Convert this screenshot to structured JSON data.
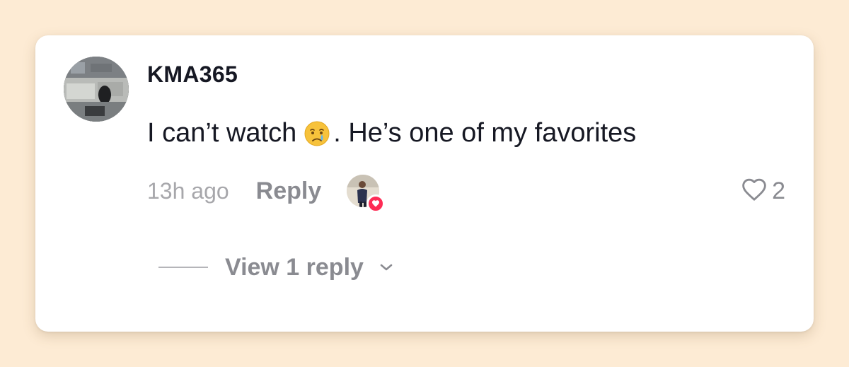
{
  "comment": {
    "username": "KMA365",
    "text_before_emoji": "I can’t watch",
    "emoji": "crying-face-emoji",
    "text_after_emoji": ". He’s one of my favorites",
    "timestamp": "13h ago",
    "reply_label": "Reply",
    "like_count": "2",
    "view_replies_label": "View 1 reply"
  },
  "icons": {
    "like": "heart-outline-icon",
    "expand": "chevron-down-icon",
    "liked_by_creator": "heart-badge-icon"
  },
  "colors": {
    "page_background": "#fdebd4",
    "card_background": "#ffffff",
    "primary_text": "#161823",
    "secondary_text": "#8a8b91",
    "timestamp_text": "#a7a7ab",
    "like_badge": "#fe2c55"
  }
}
